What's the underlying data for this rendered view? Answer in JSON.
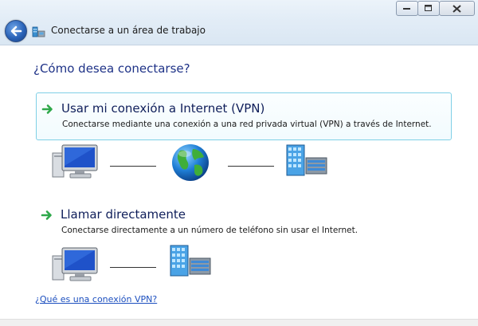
{
  "window": {
    "title": "Conectarse a un área de trabajo",
    "buttons": [
      "minimize",
      "maximize",
      "close"
    ]
  },
  "page": {
    "heading": "¿Cómo desea conectarse?",
    "options": [
      {
        "title": "Usar mi conexión a Internet (VPN)",
        "description": "Conectarse mediante una conexión a una red privada virtual (VPN) a través de Internet.",
        "selected": true,
        "diagram": [
          "computer-icon",
          "globe-icon",
          "server-icon"
        ]
      },
      {
        "title": "Llamar directamente",
        "description": "Conectarse directamente a un número de teléfono sin usar el Internet.",
        "selected": false,
        "diagram": [
          "computer-icon",
          "server-icon"
        ]
      }
    ],
    "help_link": "¿Qué es una conexión VPN?"
  },
  "colors": {
    "heading": "#1e3287",
    "link": "#1c4fbf",
    "selected_border": "#7fd0e6",
    "arrow": "#2ea84a"
  }
}
